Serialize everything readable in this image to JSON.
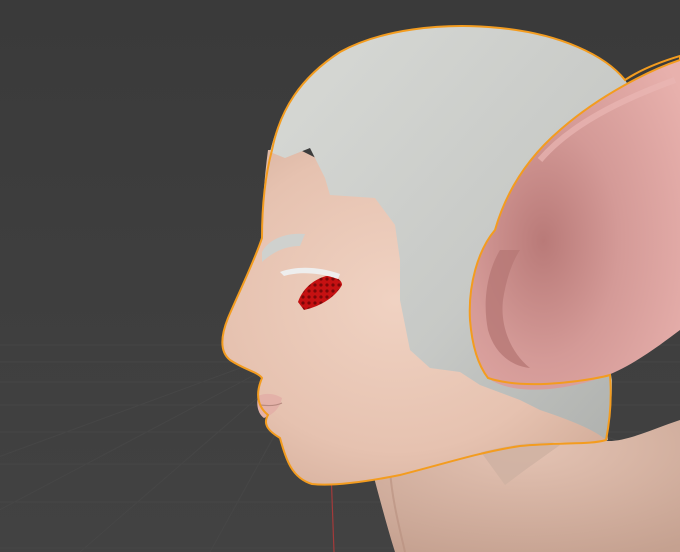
{
  "viewport": {
    "background_color": "#3d3d3d",
    "grid_color": "#474747",
    "axis_color": "#9a3a3a",
    "selection_outline_color": "#f39c1f"
  },
  "model": {
    "description_icon": "character-head-profile",
    "skin_color": "#e8c4b3",
    "hair_color": "#c9cbc8",
    "ear_color": "#d59b98",
    "eye_color": "#b80f10",
    "selected": true
  }
}
